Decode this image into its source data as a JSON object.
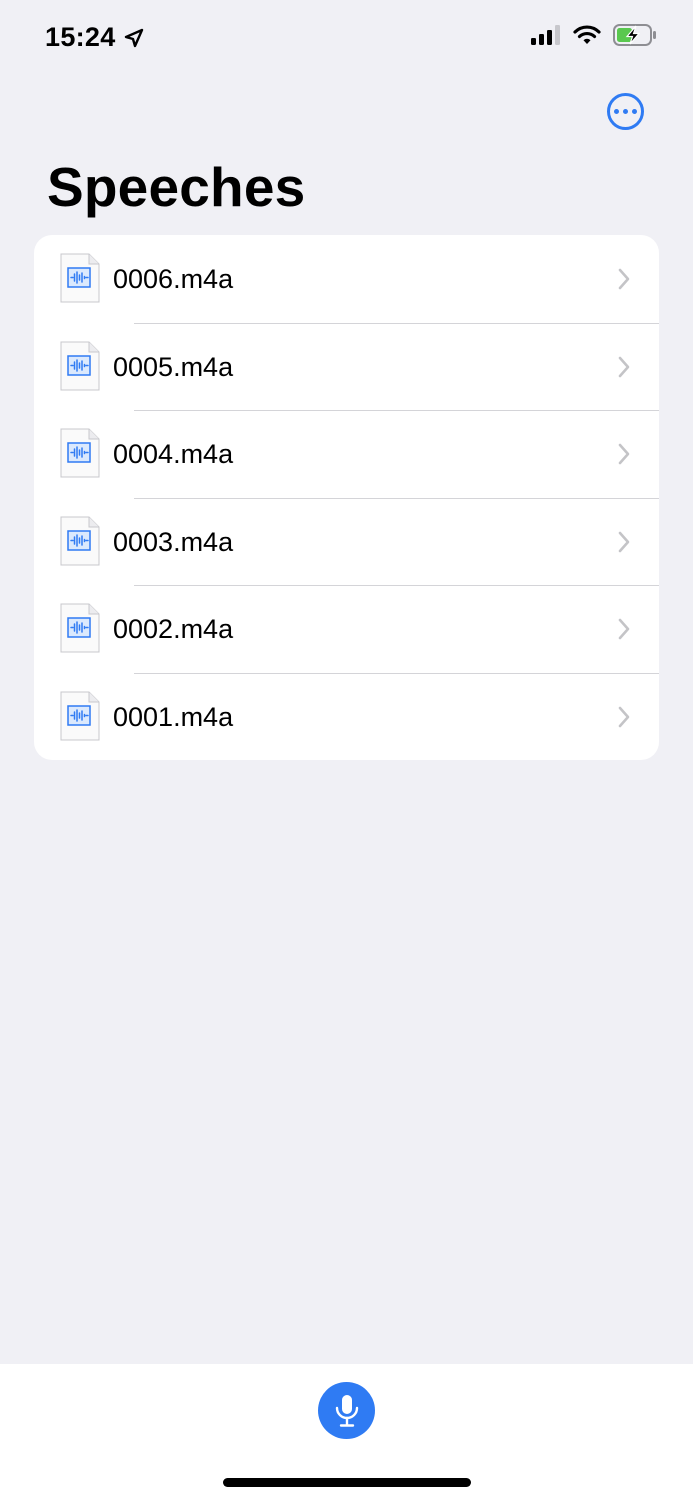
{
  "status_bar": {
    "time": "15:24",
    "icons": [
      "location-arrow-icon",
      "cellular-signal-icon",
      "wifi-icon",
      "battery-charging-icon"
    ]
  },
  "header": {
    "title": "Speeches",
    "more_icon": "ellipsis-circle-icon"
  },
  "files": [
    {
      "name": "0006.m4a",
      "icon": "audio-file-icon"
    },
    {
      "name": "0005.m4a",
      "icon": "audio-file-icon"
    },
    {
      "name": "0004.m4a",
      "icon": "audio-file-icon"
    },
    {
      "name": "0003.m4a",
      "icon": "audio-file-icon"
    },
    {
      "name": "0002.m4a",
      "icon": "audio-file-icon"
    },
    {
      "name": "0001.m4a",
      "icon": "audio-file-icon"
    }
  ],
  "toolbar": {
    "record_icon": "microphone-icon"
  },
  "colors": {
    "accent": "#2f7bf3",
    "background": "#f0f0f5",
    "card": "#ffffff",
    "separator": "#d4d4d8",
    "chevron": "#c4c4c7",
    "battery_fill": "#5ac84f"
  }
}
